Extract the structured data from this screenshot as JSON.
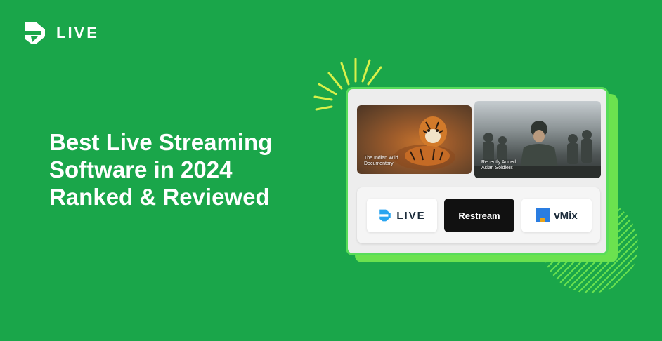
{
  "brand": {
    "name": "LIVE",
    "icon": "live-logo-icon"
  },
  "headline": {
    "lines": [
      "Best Live Streaming",
      "Software in 2024",
      "Ranked & Reviewed"
    ]
  },
  "card": {
    "thumbnails": [
      {
        "caption_line1": "The Indian Wild",
        "caption_line2": "Documentary"
      },
      {
        "caption_line1": "Recently Added",
        "caption_line2": "Asian Soldiers"
      }
    ],
    "logos": [
      {
        "name": "LIVE",
        "icon": "live-logo-icon"
      },
      {
        "name": "Restream"
      },
      {
        "name": "vMix",
        "icon": "vmix-grid-icon"
      }
    ]
  },
  "colors": {
    "background": "#1aa64a",
    "accent": "#58dc5a",
    "light_green": "#6be24f",
    "ray_yellow": "#d8f04a"
  }
}
